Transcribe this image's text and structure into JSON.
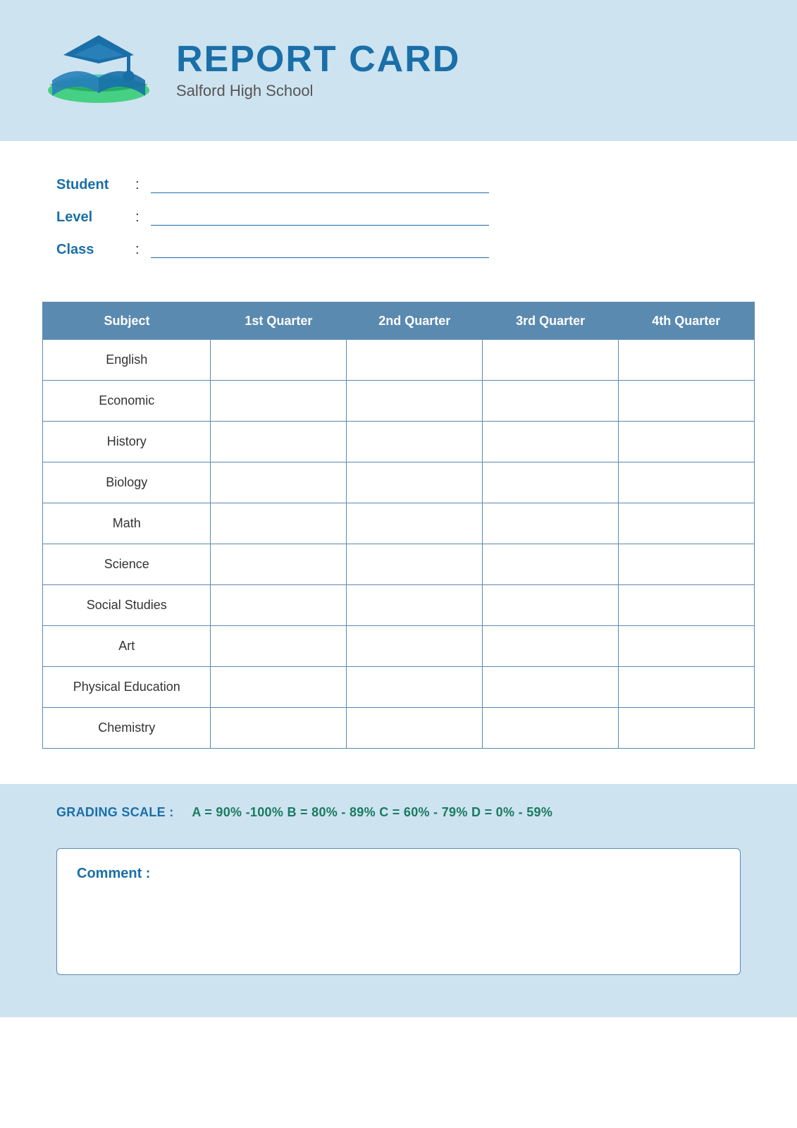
{
  "header": {
    "title": "REPORT CARD",
    "school": "Salford High School"
  },
  "info": {
    "student_label": "Student",
    "level_label": "Level",
    "class_label": "Class",
    "colon": ":"
  },
  "table": {
    "columns": [
      "Subject",
      "1st Quarter",
      "2nd Quarter",
      "3rd Quarter",
      "4th Quarter"
    ],
    "rows": [
      {
        "subject": "English"
      },
      {
        "subject": "Economic"
      },
      {
        "subject": "History"
      },
      {
        "subject": "Biology"
      },
      {
        "subject": "Math"
      },
      {
        "subject": "Science"
      },
      {
        "subject": "Social Studies"
      },
      {
        "subject": "Art"
      },
      {
        "subject": "Physical Education"
      },
      {
        "subject": "Chemistry"
      }
    ]
  },
  "grading": {
    "label": "GRADING SCALE :",
    "scale": "A = 90% -100%  B = 80% - 89%  C = 60% - 79%  D = 0% - 59%"
  },
  "comment": {
    "label": "Comment :"
  }
}
